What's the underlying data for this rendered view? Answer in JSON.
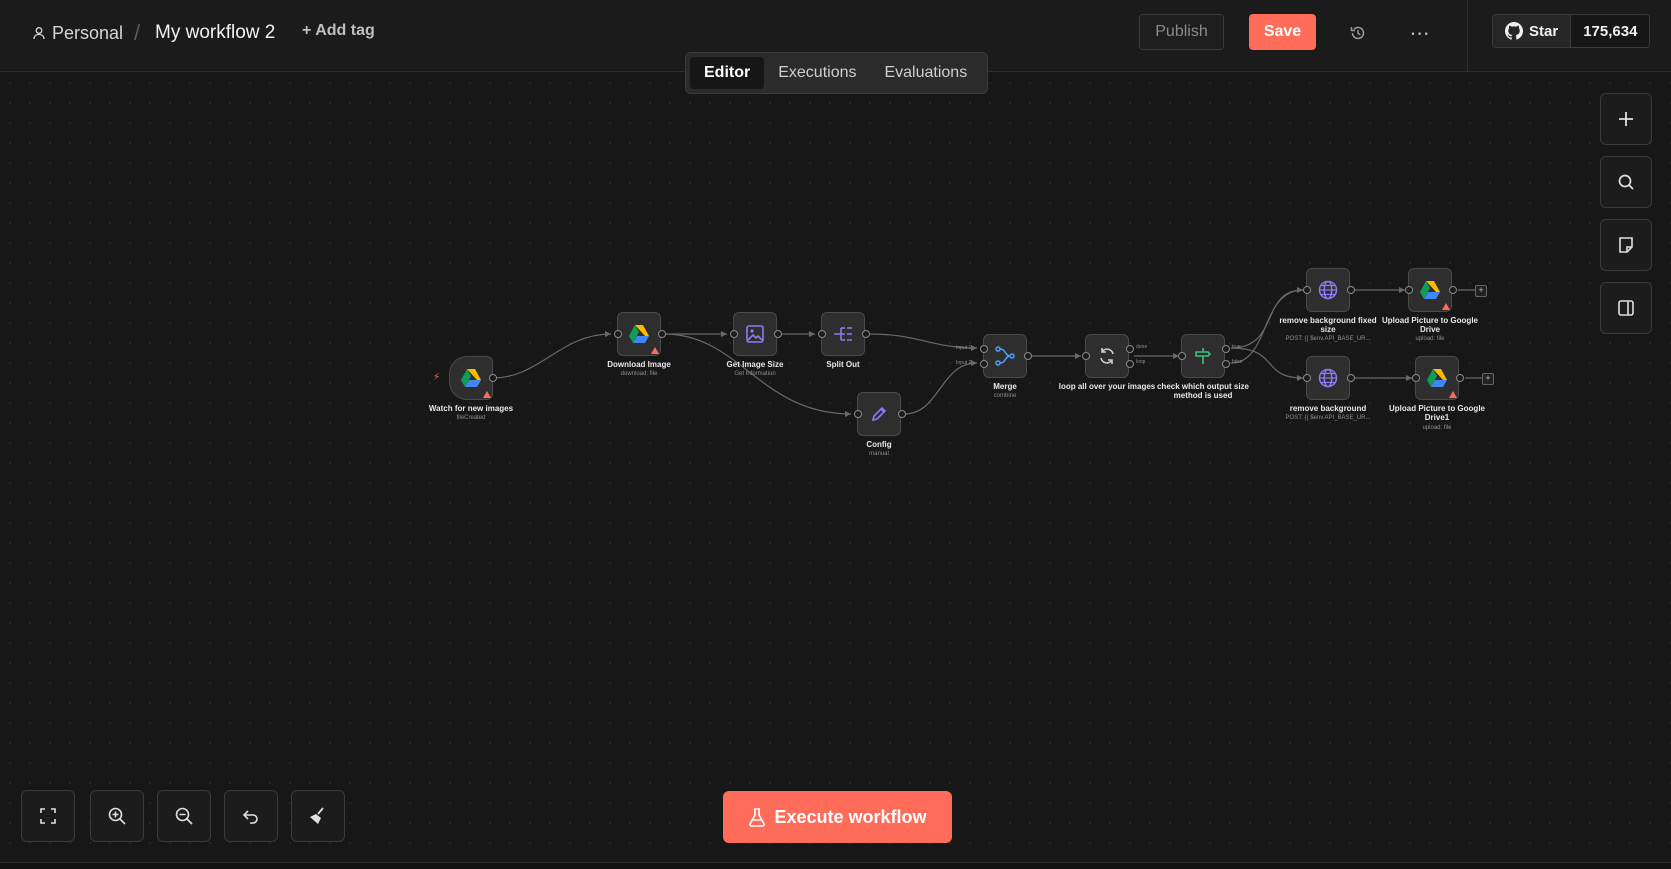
{
  "header": {
    "project": "Personal",
    "workflow_title": "My workflow 2",
    "add_tag": "+ Add tag",
    "publish": "Publish",
    "save": "Save",
    "more": "⋯",
    "github_star": "Star",
    "github_count": "175,634"
  },
  "tabs": [
    "Editor",
    "Executions",
    "Evaluations"
  ],
  "active_tab": "Editor",
  "execute_button": "Execute workflow",
  "nodes": {
    "watch": {
      "name": "Watch for new images",
      "sub": "fileCreated"
    },
    "download": {
      "name": "Download Image",
      "sub": "download: file"
    },
    "getsize": {
      "name": "Get Image Size",
      "sub": "Get Information"
    },
    "splitout": {
      "name": "Split Out",
      "sub": ""
    },
    "config": {
      "name": "Config",
      "sub": "manual"
    },
    "merge": {
      "name": "Merge",
      "sub": "combine",
      "input1": "Input 1",
      "input2": "Input 2"
    },
    "loop": {
      "name": "loop all over your images",
      "sub": "",
      "out1": "done",
      "out2": "loop"
    },
    "check": {
      "name": "check which output size method is used",
      "sub": "",
      "out1": "true",
      "out2": "false"
    },
    "rmbg1": {
      "name": "remove background fixed size",
      "sub": "POST: {{ $env.API_BASE_UR..."
    },
    "upload1": {
      "name": "Upload Picture to Google Drive",
      "sub": "upload: file"
    },
    "rmbg2": {
      "name": "remove background",
      "sub": "POST: {{ $env.API_BASE_UR..."
    },
    "upload2": {
      "name": "Upload Picture to Google Drive1",
      "sub": "upload: file"
    }
  },
  "colors": {
    "accent": "#ff6d5a",
    "background": "#171717",
    "node": "#2e2e2e",
    "icon_purple": "#8b7cf6",
    "icon_green": "#3fbf7f",
    "icon_blue": "#4aa3ff"
  }
}
